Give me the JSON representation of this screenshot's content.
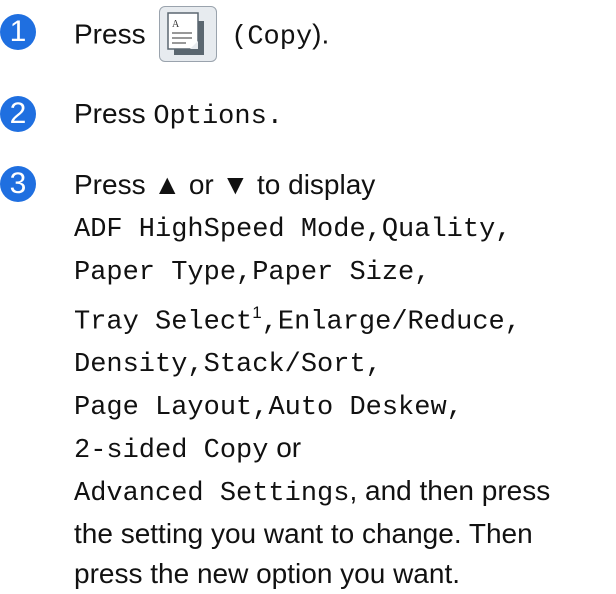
{
  "steps": [
    {
      "number": "1",
      "press": "Press",
      "icon": "copy-icon",
      "paren_open": "(",
      "button": "Copy",
      "paren_close": ")."
    },
    {
      "number": "2",
      "press": "Press",
      "button": "Options",
      "period": "."
    },
    {
      "number": "3",
      "line1": "Press ▲ or ▼ to display",
      "items": [
        "ADF HighSpeed Mode",
        "Quality",
        "Paper Type",
        "Paper Size",
        "Tray Select",
        "Enlarge/Reduce",
        "Density",
        "Stack/Sort",
        "Page Layout",
        "Auto Deskew",
        "2-sided Copy",
        "Advanced Settings"
      ],
      "footnote_mark": "1",
      "comma": ",",
      "or": "or",
      "and_then": ", and then press",
      "line_b": "the setting you want to change. Then",
      "line_c": "press the new option you want."
    }
  ],
  "colors": {
    "step_badge": "#1f6fe0"
  }
}
